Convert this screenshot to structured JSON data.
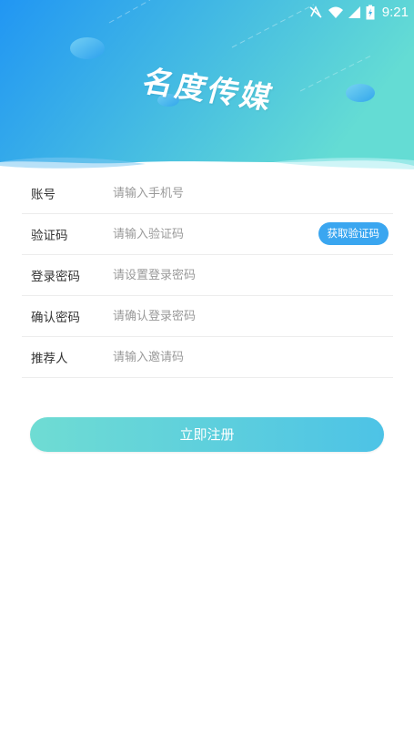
{
  "status_bar": {
    "time": "9:21",
    "icons": [
      "no-signal-icon",
      "wifi-icon",
      "cell-signal-icon",
      "battery-charging-icon"
    ]
  },
  "header": {
    "logo_text": "名度传媒",
    "gradient_start": "#2196f3",
    "gradient_end": "#64dcd4"
  },
  "form": {
    "rows": [
      {
        "label": "账号",
        "placeholder": "请输入手机号"
      },
      {
        "label": "验证码",
        "placeholder": "请输入验证码"
      },
      {
        "label": "登录密码",
        "placeholder": "请设置登录密码"
      },
      {
        "label": "确认密码",
        "placeholder": "请确认登录密码"
      },
      {
        "label": "推荐人",
        "placeholder": "请输入邀请码"
      }
    ],
    "get_code_label": "获取验证码"
  },
  "submit": {
    "label": "立即注册"
  },
  "colors": {
    "accent": "#3aa6f0",
    "button_start": "#6fdcd3",
    "button_end": "#4dc3e6"
  }
}
